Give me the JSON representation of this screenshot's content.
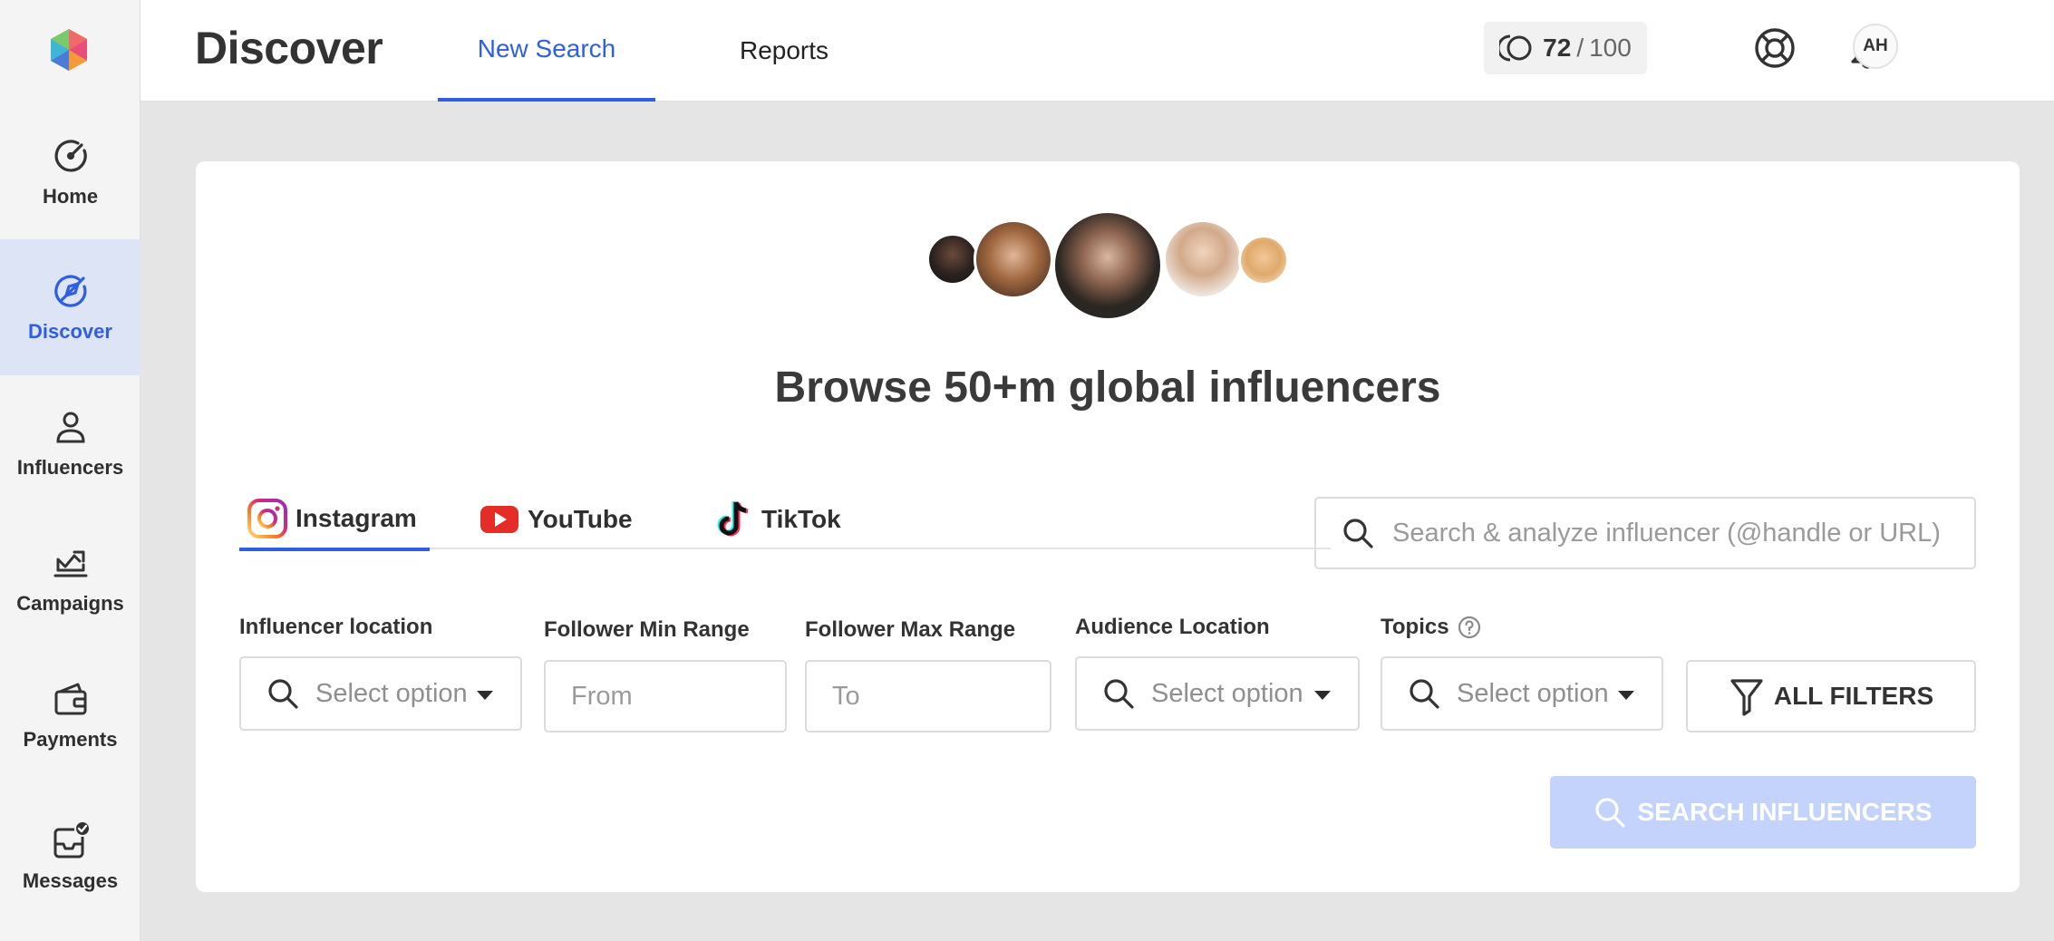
{
  "sidebar": {
    "items": [
      {
        "label": "Home",
        "icon": "gauge-icon"
      },
      {
        "label": "Discover",
        "icon": "compass-icon",
        "active": true
      },
      {
        "label": "Influencers",
        "icon": "user-icon"
      },
      {
        "label": "Campaigns",
        "icon": "chart-icon"
      },
      {
        "label": "Payments",
        "icon": "wallet-icon"
      },
      {
        "label": "Messages",
        "icon": "inbox-icon"
      }
    ]
  },
  "header": {
    "title": "Discover",
    "tabs": [
      {
        "label": "New Search",
        "active": true
      },
      {
        "label": "Reports",
        "active": false
      }
    ],
    "credits": {
      "used": "72",
      "separator": "/",
      "total": "100"
    },
    "user_initials": "AH"
  },
  "main": {
    "hero_title": "Browse 50+m global influencers",
    "platforms": [
      {
        "label": "Instagram",
        "active": true
      },
      {
        "label": "YouTube",
        "active": false
      },
      {
        "label": "TikTok",
        "active": false
      }
    ],
    "profile_search_placeholder": "Search & analyze influencer (@handle or URL)",
    "filters": {
      "influencer_location": {
        "label": "Influencer location",
        "placeholder": "Select option"
      },
      "follower_min": {
        "label": "Follower Min Range",
        "placeholder": "From"
      },
      "follower_max": {
        "label": "Follower Max Range",
        "placeholder": "To"
      },
      "audience_location": {
        "label": "Audience Location",
        "placeholder": "Select option"
      },
      "topics": {
        "label": "Topics",
        "placeholder": "Select option"
      }
    },
    "all_filters_label": "ALL FILTERS",
    "search_button_label": "SEARCH INFLUENCERS"
  },
  "colors": {
    "accent": "#2e5fe0",
    "disabled_button": "#c4d3fb",
    "sidebar_active_bg": "#dde4f5",
    "page_bg": "#e5e5e5"
  }
}
